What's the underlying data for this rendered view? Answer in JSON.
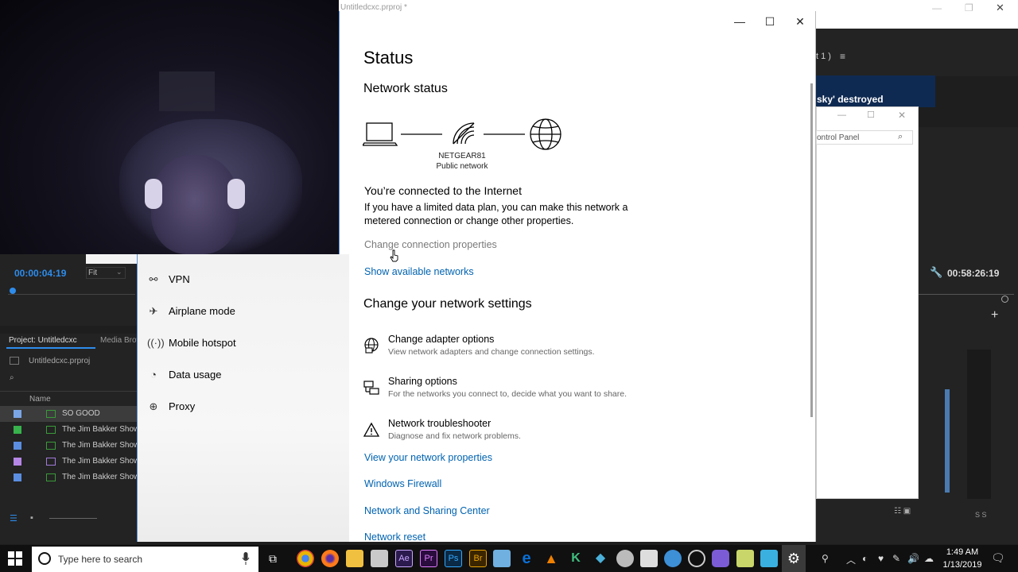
{
  "background_app": {
    "title": "Untitledcxc.prproj *",
    "timecode_left": "00:00:04:19",
    "fit_label": "Fit",
    "project_tab": "Project: Untitledcxc",
    "media_tab": "Media Brow",
    "project_file": "Untitledcxc.prproj",
    "name_column": "Name",
    "items": [
      {
        "label": "SO GOOD",
        "color": "#7aa6e6"
      },
      {
        "label": "The Jim Bakker Show -",
        "color": "#37b24d"
      },
      {
        "label": "The Jim Bakker Show -",
        "color": "#5b8ee0"
      },
      {
        "label": "The Jim Bakker Show -",
        "color": "#b586e6"
      },
      {
        "label": "The Jim Bakker Show -",
        "color": "#5b8ee0"
      }
    ],
    "sequence_label": "t 1 )",
    "headline": "sky' destroyed",
    "timecode_right": "00:58:26:19",
    "control_panel_search": "ontrol Panel"
  },
  "window": {
    "minimize": "—",
    "maximize": "☐",
    "close": "✕"
  },
  "nav": {
    "items": [
      {
        "label": "VPN",
        "icon": "vpn-icon"
      },
      {
        "label": "Airplane mode",
        "icon": "airplane-icon"
      },
      {
        "label": "Mobile hotspot",
        "icon": "hotspot-icon"
      },
      {
        "label": "Data usage",
        "icon": "data-usage-icon"
      },
      {
        "label": "Proxy",
        "icon": "globe-icon"
      }
    ]
  },
  "main": {
    "title": "Status",
    "network_status_heading": "Network status",
    "network_name": "NETGEAR81",
    "network_type": "Public network",
    "connected_heading": "You’re connected to the Internet",
    "connected_text": "If you have a limited data plan, you can make this network a metered connection or change other properties.",
    "change_properties": "Change connection properties",
    "show_networks": "Show available networks",
    "change_settings_heading": "Change your network settings",
    "options": [
      {
        "title": "Change adapter options",
        "desc": "View network adapters and change connection settings.",
        "icon": "adapter-icon"
      },
      {
        "title": "Sharing options",
        "desc": "For the networks you connect to, decide what you want to share.",
        "icon": "sharing-icon"
      },
      {
        "title": "Network troubleshooter",
        "desc": "Diagnose and fix network problems.",
        "icon": "warning-icon"
      }
    ],
    "view_properties": "View your network properties",
    "firewall": "Windows Firewall",
    "sharing_center": "Network and Sharing Center",
    "network_reset": "Network reset"
  },
  "taskbar": {
    "search_placeholder": "Type here to search",
    "time": "1:49 AM",
    "date": "1/13/2019",
    "apps": [
      {
        "icon": "chrome-icon",
        "color": "#e8b400"
      },
      {
        "icon": "firefox-icon",
        "color": "#ff7a1a"
      },
      {
        "icon": "file-explorer-icon",
        "color": "#f0c040"
      },
      {
        "icon": "app-icon",
        "color": "#c9c9c9"
      },
      {
        "icon": "after-effects-icon",
        "color": "#2b1a4d"
      },
      {
        "icon": "premiere-icon",
        "color": "#2a0c3d"
      },
      {
        "icon": "photoshop-icon",
        "color": "#0b2a45"
      },
      {
        "icon": "bridge-icon",
        "color": "#3a2500"
      },
      {
        "icon": "app-icon",
        "color": "#6fb0e0"
      },
      {
        "icon": "edge-icon",
        "color": "#0a6fd6"
      },
      {
        "icon": "vlc-icon",
        "color": "#f08000"
      },
      {
        "icon": "app-icon",
        "color": "#3fbf7f"
      },
      {
        "icon": "app-icon",
        "color": "#4ab0d9"
      },
      {
        "icon": "app-icon",
        "color": "#bbbbbb"
      },
      {
        "icon": "image-icon",
        "color": "#dddddd"
      },
      {
        "icon": "app-icon",
        "color": "#3d8fd6"
      },
      {
        "icon": "app-icon",
        "color": "#cccccc"
      },
      {
        "icon": "app-icon",
        "color": "#7b5cd6"
      },
      {
        "icon": "app-icon",
        "color": "#c8d66a"
      },
      {
        "icon": "app-icon",
        "color": "#3ab0e0"
      }
    ]
  }
}
